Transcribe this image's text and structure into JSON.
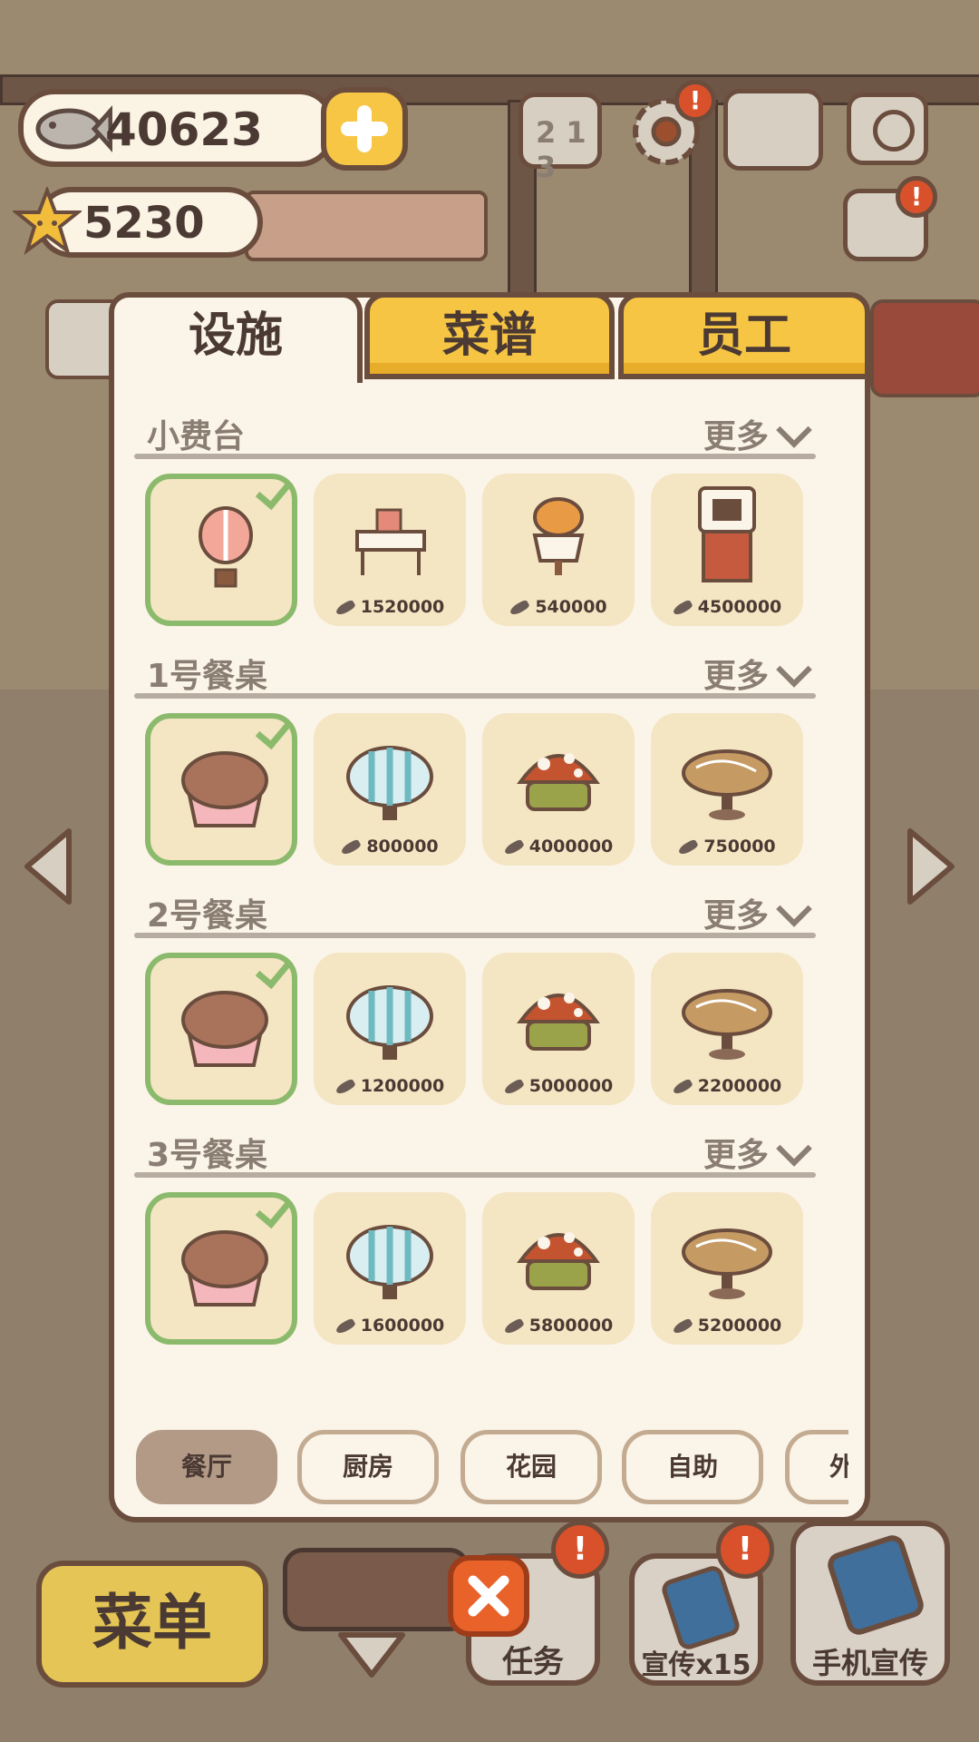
{
  "currency": {
    "fish": "40623",
    "stars": "5230"
  },
  "tabs": [
    {
      "label": "设施",
      "active": true
    },
    {
      "label": "菜谱",
      "active": false
    },
    {
      "label": "员工",
      "active": false
    }
  ],
  "sections": [
    {
      "title": "小费台",
      "more": "更多",
      "items": [
        {
          "owned": true,
          "price": "",
          "icon": "hot-air-balloon-icon"
        },
        {
          "owned": false,
          "price": "1520000",
          "icon": "gift-desk-icon"
        },
        {
          "owned": false,
          "price": "540000",
          "icon": "pumpkin-stand-icon"
        },
        {
          "owned": false,
          "price": "4500000",
          "icon": "brick-chimney-icon"
        }
      ]
    },
    {
      "title": "1号餐桌",
      "more": "更多",
      "items": [
        {
          "owned": true,
          "price": "",
          "icon": "chocolate-cupcake-table-icon"
        },
        {
          "owned": false,
          "price": "800000",
          "icon": "striped-macaron-table-icon"
        },
        {
          "owned": false,
          "price": "4000000",
          "icon": "mushroom-table-icon"
        },
        {
          "owned": false,
          "price": "750000",
          "icon": "wooden-round-table-icon"
        }
      ]
    },
    {
      "title": "2号餐桌",
      "more": "更多",
      "items": [
        {
          "owned": true,
          "price": "",
          "icon": "chocolate-cupcake-table-icon"
        },
        {
          "owned": false,
          "price": "1200000",
          "icon": "striped-macaron-table-icon"
        },
        {
          "owned": false,
          "price": "5000000",
          "icon": "mushroom-table-icon"
        },
        {
          "owned": false,
          "price": "2200000",
          "icon": "wooden-round-table-icon"
        }
      ]
    },
    {
      "title": "3号餐桌",
      "more": "更多",
      "items": [
        {
          "owned": true,
          "price": "",
          "icon": "chocolate-cupcake-table-icon"
        },
        {
          "owned": false,
          "price": "1600000",
          "icon": "striped-macaron-table-icon"
        },
        {
          "owned": false,
          "price": "5800000",
          "icon": "mushroom-table-icon"
        },
        {
          "owned": false,
          "price": "5200000",
          "icon": "wooden-round-table-icon"
        }
      ]
    }
  ],
  "categories": [
    {
      "label": "餐厅",
      "active": true
    },
    {
      "label": "厨房",
      "active": false
    },
    {
      "label": "花园",
      "active": false
    },
    {
      "label": "自助",
      "active": false
    },
    {
      "label": "外",
      "active": false
    }
  ],
  "bottom": {
    "menu": "菜单",
    "task": "任务",
    "promo": "宣传x15",
    "phone_promo": "手机宣传",
    "badge": "!"
  },
  "colors": {
    "accent": "#f6c544",
    "owned": "#8cba6c",
    "close": "#e8622a",
    "panel": "#fbf4e8"
  }
}
